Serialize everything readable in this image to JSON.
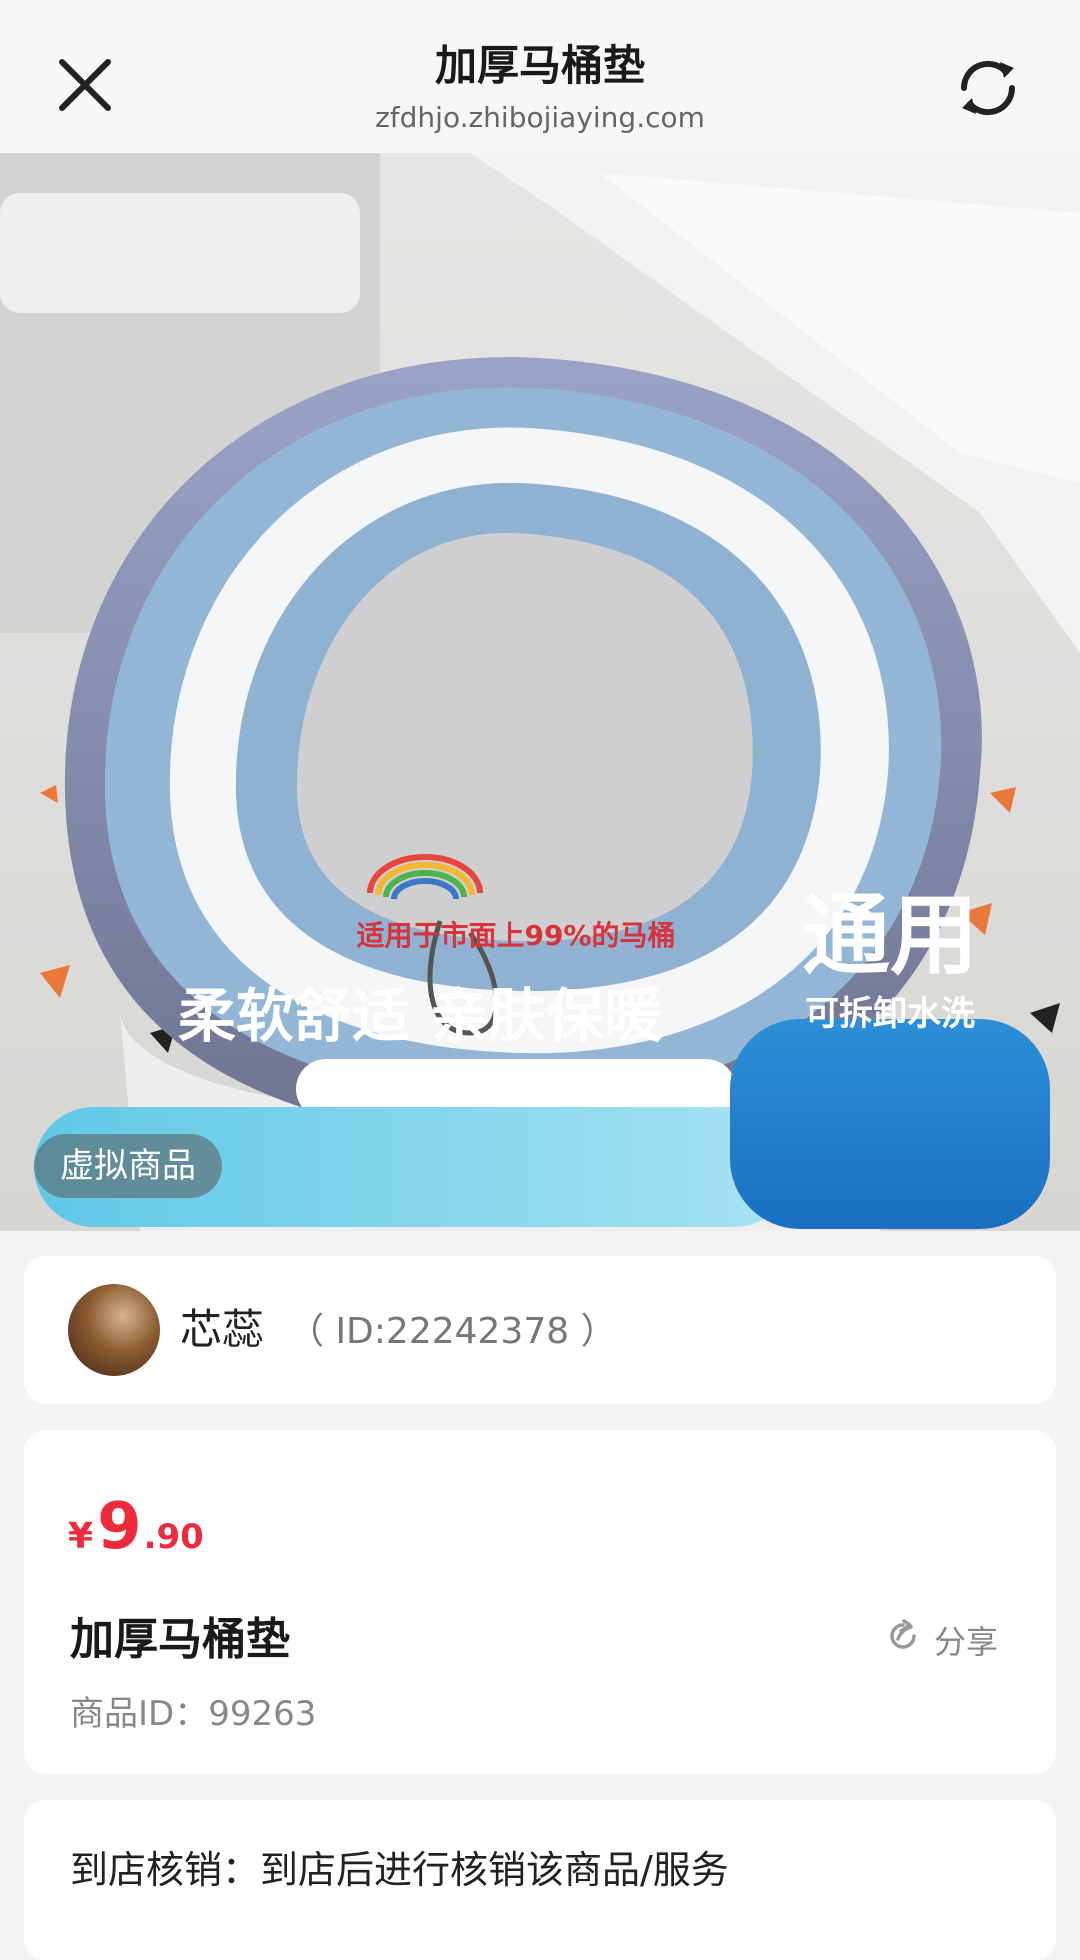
{
  "header": {
    "title": "加厚马桶垫",
    "url": "zfdhjo.zhibojiaying.com",
    "close_icon": "close-icon",
    "refresh_icon": "refresh-icon"
  },
  "hero": {
    "top_banner": "适用于市面上99%的马桶",
    "main_banner": "柔软舒适 亲肤保暖",
    "badge_big": "通用",
    "badge_small": "可拆卸水洗",
    "virtual_badge": "虚拟商品"
  },
  "shop": {
    "name": "芯蕊",
    "id_text": "（ ID:22242378 ）"
  },
  "price": {
    "currency": "¥",
    "integer": "9",
    "decimal": ".90",
    "color": "#ee2b3c"
  },
  "product": {
    "title": "加厚马桶垫",
    "id_text": "商品ID：99263",
    "share_label": "分享",
    "share_icon": "share-icon"
  },
  "verify": {
    "text": "到店核销：到店后进行核销该商品/服务"
  }
}
